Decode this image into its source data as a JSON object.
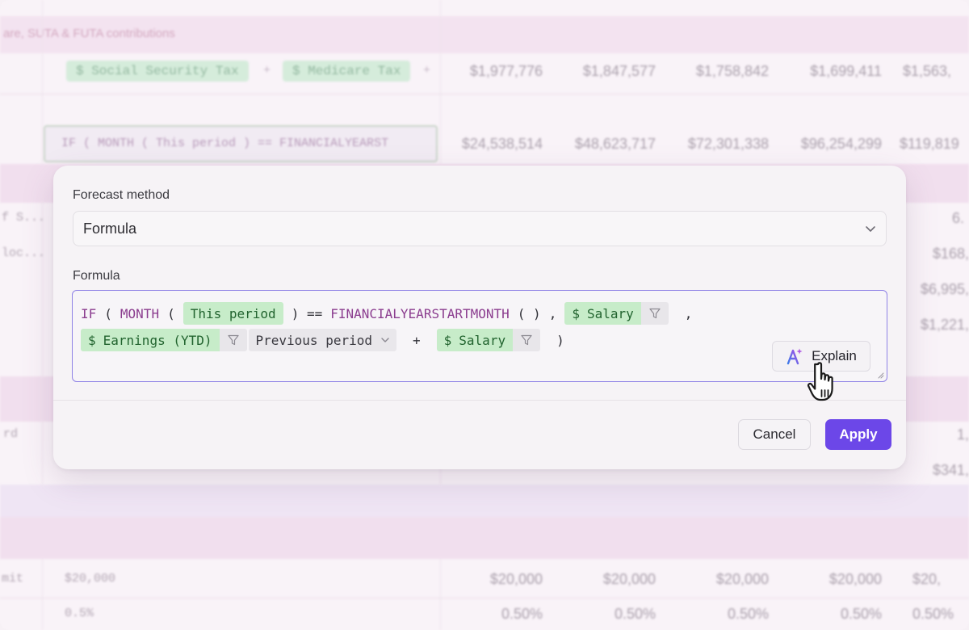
{
  "background": {
    "section_title": "are, SUTA & FUTA contributions",
    "tax_row": {
      "chips": [
        "$ Social Security Tax",
        "$ Medicare Tax"
      ],
      "values": [
        "$1,977,776",
        "$1,847,577",
        "$1,758,842",
        "$1,699,411",
        "$1,563,"
      ]
    },
    "formula_row": {
      "formula": "IF ( MONTH (  This period  ) == FINANCIALYEARST",
      "values": [
        "$24,538,514",
        "$48,623,717",
        "$72,301,338",
        "$96,254,299",
        "$119,819"
      ]
    },
    "side_labels": [
      "f S...",
      "loc...",
      "rd",
      "mit"
    ],
    "right_values": [
      "6.",
      "$168,",
      "$6,995,",
      "$1,221,",
      "1,",
      "$341,"
    ],
    "amount_row": {
      "label": "$20,000",
      "values": [
        "$20,000",
        "$20,000",
        "$20,000",
        "$20,000",
        "$20,"
      ]
    },
    "rate_row": {
      "label": "0.5%",
      "values": [
        "0.50%",
        "0.50%",
        "0.50%",
        "0.50%",
        "0.50%"
      ]
    }
  },
  "modal": {
    "forecast_method_label": "Forecast method",
    "forecast_method_value": "Formula",
    "formula_label": "Formula",
    "formula": {
      "line1": {
        "if": "IF",
        "open1": "(",
        "month": "MONTH",
        "open2": "(",
        "this_period": "This period",
        "close_eq": ") ==",
        "fysm": "FINANCIALYEARSTARTMONTH",
        "parens": "( )",
        "comma1": ",",
        "salary_chip": "Salary",
        "comma2": ","
      },
      "line2": {
        "earnings_chip": "Earnings (YTD)",
        "period_select": "Previous period",
        "plus": "+",
        "salary_chip": "Salary",
        "close": ")"
      },
      "currency_symbol": "$"
    },
    "explain_button": "Explain",
    "cancel_button": "Cancel",
    "apply_button": "Apply"
  },
  "colors": {
    "accent": "#6c47e8",
    "chip_green": "#c7ecc9",
    "function_purple": "#8b3d8f",
    "editor_focus_border": "#8f82e6"
  },
  "icons": {
    "select_chevron": "chevron-down-icon",
    "filter": "filter-icon",
    "explain": "ai-sparkle-icon",
    "cursor": "hand-pointer-cursor-icon"
  }
}
